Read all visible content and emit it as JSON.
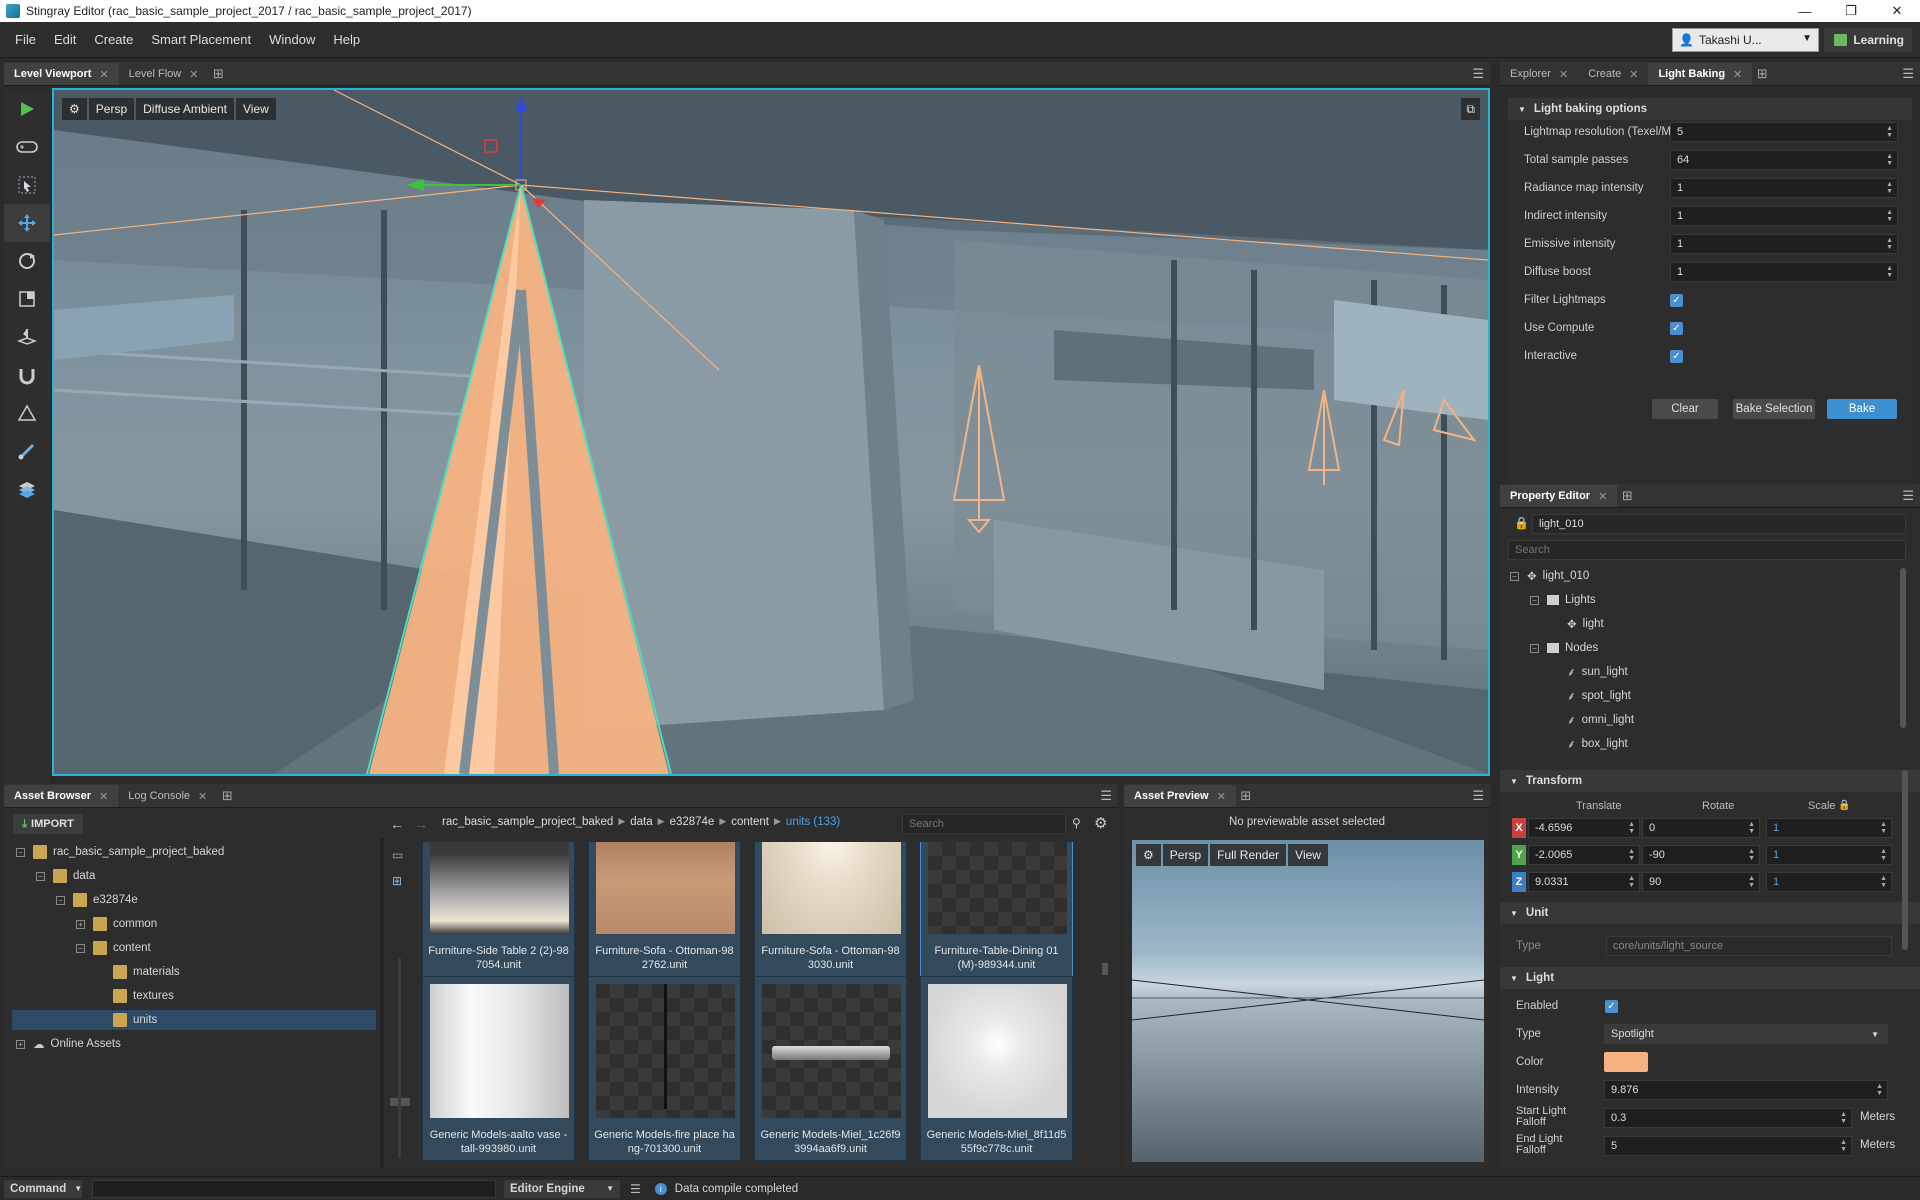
{
  "window": {
    "title": "Stingray Editor (rac_basic_sample_project_2017 / rac_basic_sample_project_2017)",
    "minimize": "—",
    "maximize": "❐",
    "close": "✕"
  },
  "menu": [
    "File",
    "Edit",
    "Create",
    "Smart Placement",
    "Window",
    "Help"
  ],
  "user": {
    "name": "Takashi U...",
    "learning": "Learning"
  },
  "viewport_tabs": [
    {
      "label": "Level Viewport"
    },
    {
      "label": "Level Flow"
    }
  ],
  "viewport": {
    "camera": "Persp",
    "shading": "Diffuse Ambient",
    "view": "View"
  },
  "right_tabs": [
    {
      "label": "Explorer"
    },
    {
      "label": "Create"
    },
    {
      "label": "Light Baking"
    }
  ],
  "light_baking": {
    "section": "Light baking options",
    "fields": [
      {
        "label": "Lightmap resolution (Texel/Meter)",
        "value": "5"
      },
      {
        "label": "Total sample passes",
        "value": "64"
      },
      {
        "label": "Radiance map intensity",
        "value": "1"
      },
      {
        "label": "Indirect intensity",
        "value": "1"
      },
      {
        "label": "Emissive intensity",
        "value": "1"
      },
      {
        "label": "Diffuse boost",
        "value": "1"
      }
    ],
    "checks": [
      {
        "label": "Filter Lightmaps",
        "checked": true
      },
      {
        "label": "Use Compute",
        "checked": true
      },
      {
        "label": "Interactive",
        "checked": true
      }
    ],
    "buttons": {
      "clear": "Clear",
      "bake_selection": "Bake Selection",
      "bake": "Bake"
    }
  },
  "property_editor": {
    "tab": "Property Editor",
    "object_name": "light_010",
    "search_placeholder": "Search",
    "tree": [
      {
        "label": "light_010",
        "level": 0
      },
      {
        "label": "Lights",
        "level": 1
      },
      {
        "label": "light",
        "level": 2
      },
      {
        "label": "Nodes",
        "level": 1
      },
      {
        "label": "sun_light",
        "level": 2
      },
      {
        "label": "spot_light",
        "level": 2
      },
      {
        "label": "omni_light",
        "level": 2
      },
      {
        "label": "box_light",
        "level": 2
      }
    ],
    "transform": {
      "title": "Transform",
      "headers": [
        "Translate",
        "Rotate",
        "Scale"
      ],
      "rows": [
        {
          "axis": "X",
          "t": "-4.6596",
          "r": "0",
          "s": "1",
          "color": "#c8423b"
        },
        {
          "axis": "Y",
          "t": "-2.0065",
          "r": "-90",
          "s": "1",
          "color": "#4fa34a"
        },
        {
          "axis": "Z",
          "t": "9.0331",
          "r": "90",
          "s": "1",
          "color": "#3d7fc4"
        }
      ]
    },
    "unit": {
      "title": "Unit",
      "type_label": "Type",
      "type_value": "core/units/light_source"
    },
    "light": {
      "title": "Light",
      "enabled_label": "Enabled",
      "type_label": "Type",
      "type_value": "Spotlight",
      "color_label": "Color",
      "color": "#f6b382",
      "intensity_label": "Intensity",
      "intensity": "9.876",
      "start_label": "Start Light Falloff",
      "start": "0.3",
      "start_unit": "Meters",
      "end_label": "End Light Falloff",
      "end": "5",
      "end_unit": "Meters"
    }
  },
  "asset_browser": {
    "tabs": [
      {
        "label": "Asset Browser"
      },
      {
        "label": "Log Console"
      }
    ],
    "import": "IMPORT",
    "breadcrumb": [
      "rac_basic_sample_project_baked",
      "data",
      "e32874e",
      "content",
      "units (133)"
    ],
    "search_placeholder": "Search",
    "tree": [
      {
        "label": "rac_basic_sample_project_baked",
        "level": 0
      },
      {
        "label": "data",
        "level": 1
      },
      {
        "label": "e32874e",
        "level": 2
      },
      {
        "label": "common",
        "level": 3
      },
      {
        "label": "content",
        "level": 3
      },
      {
        "label": "materials",
        "level": 4
      },
      {
        "label": "textures",
        "level": 4
      },
      {
        "label": "units",
        "level": 4
      },
      {
        "label": "Online Assets",
        "level": 0
      }
    ],
    "assets": [
      {
        "name": "Furniture-Side Table 2 (2)-98 7054.unit"
      },
      {
        "name": "Furniture-Sofa - Ottoman-98 2762.unit"
      },
      {
        "name": "Furniture-Sofa - Ottoman-98 3030.unit"
      },
      {
        "name": "Furniture-Table-Dining 01 (M)-989344.unit"
      },
      {
        "name": "Generic Models-aalto vase - tall-993980.unit"
      },
      {
        "name": "Generic Models-fire place ha ng-701300.unit"
      },
      {
        "name": "Generic Models-Miel_1c26f9 3994aa6f9.unit"
      },
      {
        "name": "Generic Models-Miel_8f11d5 55f9c778c.unit"
      }
    ]
  },
  "asset_preview": {
    "tab": "Asset Preview",
    "message": "No previewable asset selected",
    "camera": "Persp",
    "mode": "Full Render",
    "view": "View"
  },
  "status": {
    "command": "Command",
    "engine": "Editor Engine",
    "message": "Data compile completed"
  }
}
